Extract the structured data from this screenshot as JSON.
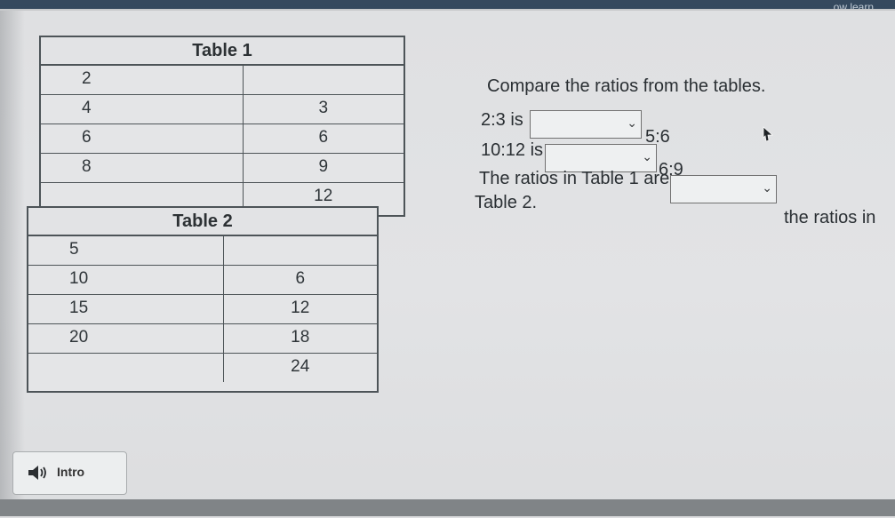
{
  "header": {
    "brand_text": "ow learn..."
  },
  "table1": {
    "title": "Table 1",
    "rows": [
      {
        "left": "2",
        "right": ""
      },
      {
        "left": "4",
        "right": "3"
      },
      {
        "left": "6",
        "right": "6"
      },
      {
        "left": "8",
        "right": "9"
      },
      {
        "left": "",
        "right": "12"
      }
    ]
  },
  "table2": {
    "title": "Table 2",
    "rows": [
      {
        "left": "5",
        "right": ""
      },
      {
        "left": "10",
        "right": "6"
      },
      {
        "left": "15",
        "right": "12"
      },
      {
        "left": "20",
        "right": "18"
      },
      {
        "left": "",
        "right": "24"
      }
    ]
  },
  "question": {
    "prompt": "Compare the ratios from the tables.",
    "line1_prefix": "2:3 is",
    "line1_suffix": "5:6",
    "line2_prefix": "10:12 is",
    "line2_suffix": "6:9",
    "line3_prefix": "The ratios in Table 1 are",
    "line3_suffix": "the ratios in",
    "line4_text": "Table 2."
  },
  "intro": {
    "label": "Intro"
  }
}
